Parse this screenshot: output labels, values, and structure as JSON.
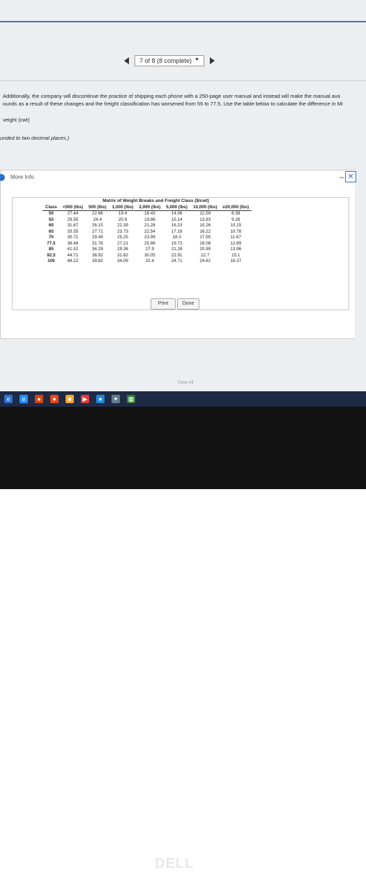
{
  "pager": {
    "label": "7 of 8 (8 complete)"
  },
  "question": {
    "line1": "Additionally, the company will discontinue the practice of shipping each phone with a 250-page user manual and instead will make the manual ava",
    "line2": "ounds as a result of these changes and the freight classification has worsened from 55 to 77.5. Use the table below to calculate the difference in Mi",
    "line3": "veight (cwt)",
    "hint": "unded to two decimal places.)"
  },
  "dialog": {
    "title": "More Info",
    "table_title": "Matrix of Weight Breaks and Freight Class ($/cwt)",
    "headers": [
      "Class",
      "<500 (lbs)",
      "500 (lbs)",
      "1,000 (lbs)",
      "2,000 (lbs)",
      "5,000 (lbs)",
      "10,000 (lbs)",
      "≥20,000 (lbs)"
    ],
    "rows": [
      [
        "50",
        "27.44",
        "22.66",
        "19.4",
        "18.43",
        "14.06",
        "12.59",
        "8.38"
      ],
      [
        "55",
        "29.55",
        "24.4",
        "20.9",
        "19.86",
        "15.14",
        "13.93",
        "9.26"
      ],
      [
        "60",
        "31.67",
        "26.15",
        "22.39",
        "21.28",
        "16.23",
        "15.26",
        "10.15"
      ],
      [
        "65",
        "33.55",
        "27.71",
        "23.73",
        "22.54",
        "17.19",
        "16.22",
        "10.78"
      ],
      [
        "70",
        "35.71",
        "29.49",
        "25.25",
        "23.99",
        "18.3",
        "17.55",
        "11.67"
      ],
      [
        "77.5",
        "38.48",
        "31.78",
        "27.21",
        "25.86",
        "19.72",
        "19.08",
        "12.69"
      ],
      [
        "85",
        "41.52",
        "34.29",
        "29.36",
        "27.9",
        "21.28",
        "20.99",
        "13.96"
      ],
      [
        "92.5",
        "44.71",
        "36.92",
        "31.62",
        "30.05",
        "22.91",
        "22.7",
        "15.1"
      ],
      [
        "100",
        "48.22",
        "39.82",
        "34.09",
        "32.4",
        "24.71",
        "24.62",
        "16.37"
      ]
    ],
    "print_label": "Print",
    "done_label": "Done"
  },
  "footer": {
    "clear_all": "Clear All"
  },
  "brand": {
    "logo": "DELL"
  },
  "colors": {
    "accent": "#2d6fd2",
    "topbar": "#4a6fb0"
  }
}
